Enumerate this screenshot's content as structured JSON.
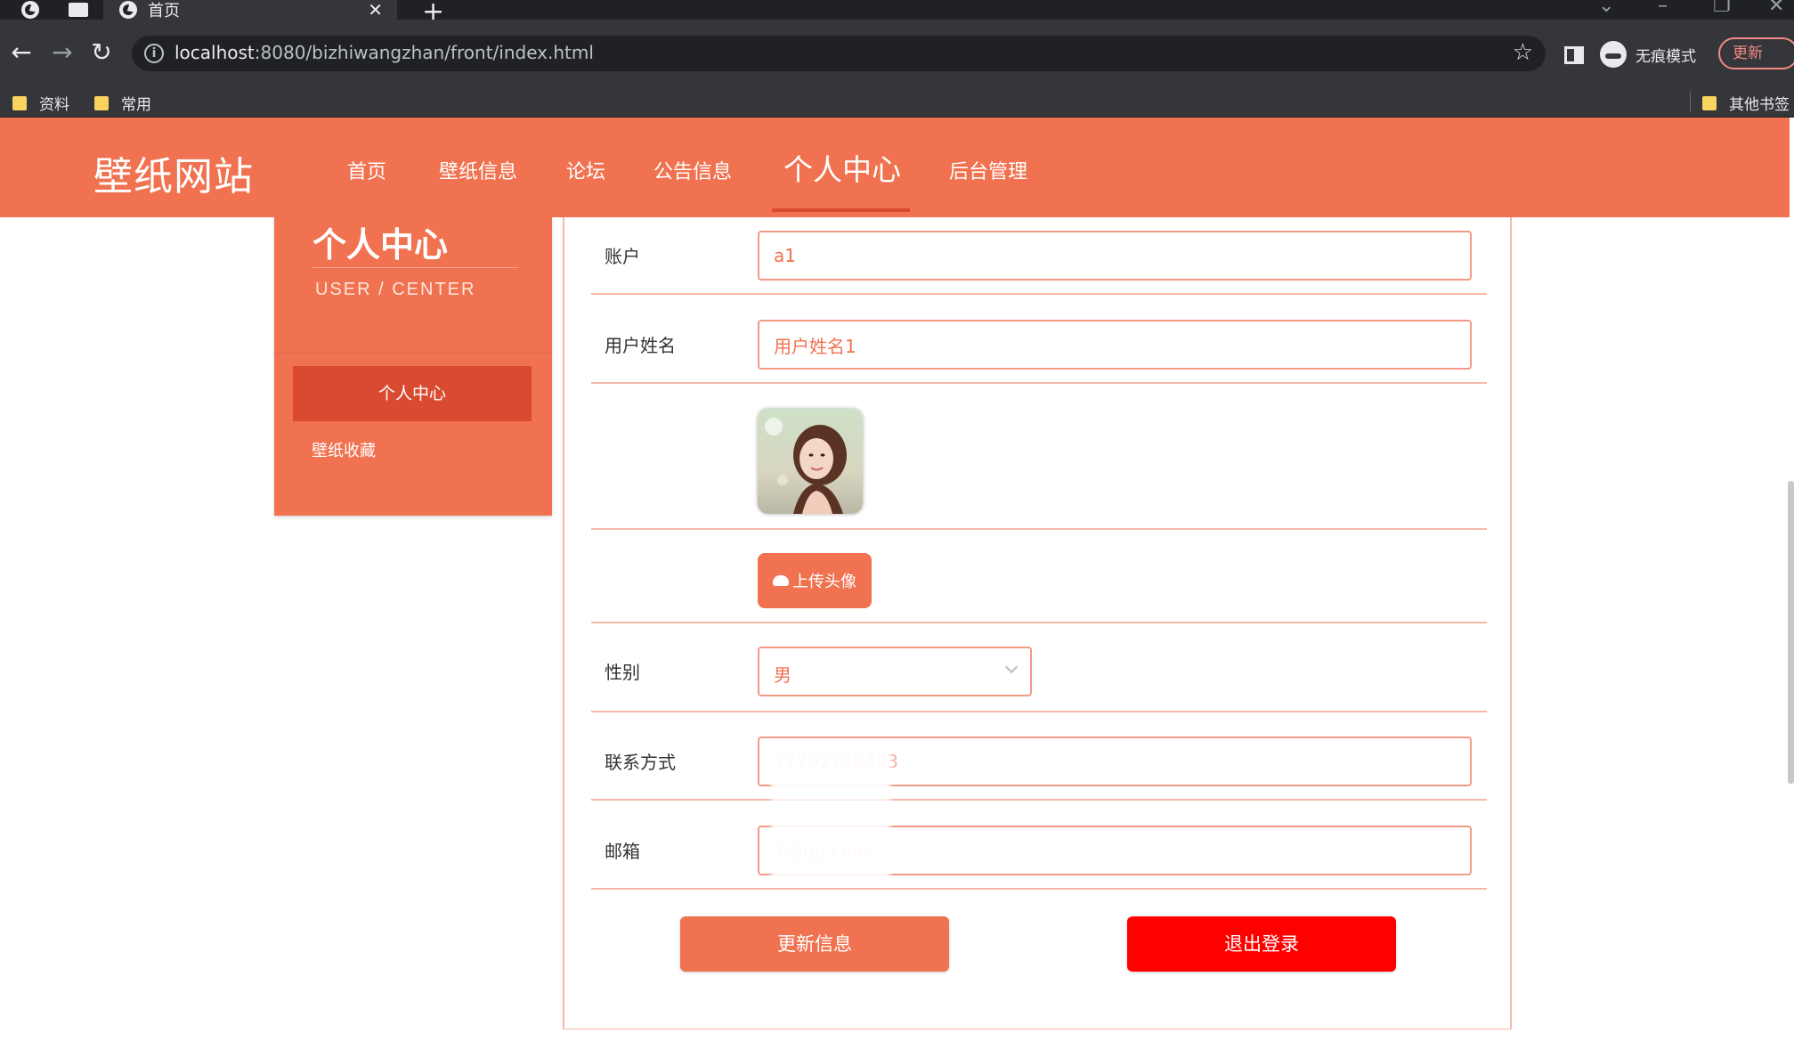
{
  "browser": {
    "tab_title": "首页",
    "tab_close": "✕",
    "new_tab": "+",
    "url_host": "localhost",
    "url_rest": ":8080/bizhiwangzhan/front/index.html",
    "incognito_label": "无痕模式",
    "update_label": "更新",
    "bookmarks": [
      "资料",
      "常用"
    ],
    "other_bookmarks": "其他书签"
  },
  "site": {
    "logo": "壁纸网站",
    "nav": [
      "首页",
      "壁纸信息",
      "论坛",
      "公告信息",
      "个人中心",
      "后台管理"
    ]
  },
  "panel": {
    "title": "个人中心",
    "subtitle": "USER / CENTER",
    "menu": [
      "个人中心",
      "壁纸收藏"
    ]
  },
  "form": {
    "account_label": "账户",
    "account_value": "a1",
    "name_label": "用户姓名",
    "name_value": "用户姓名1",
    "upload_label": "上传头像",
    "gender_label": "性别",
    "gender_value": "男",
    "phone_label": "联系方式",
    "phone_value": "17702738483",
    "email_label": "邮箱",
    "email_value": "1@qq.com",
    "update_button": "更新信息",
    "logout_button": "退出登录"
  },
  "colors": {
    "brand": "#f07250",
    "brand_dark": "#d94a30",
    "danger": "#ff0000"
  }
}
